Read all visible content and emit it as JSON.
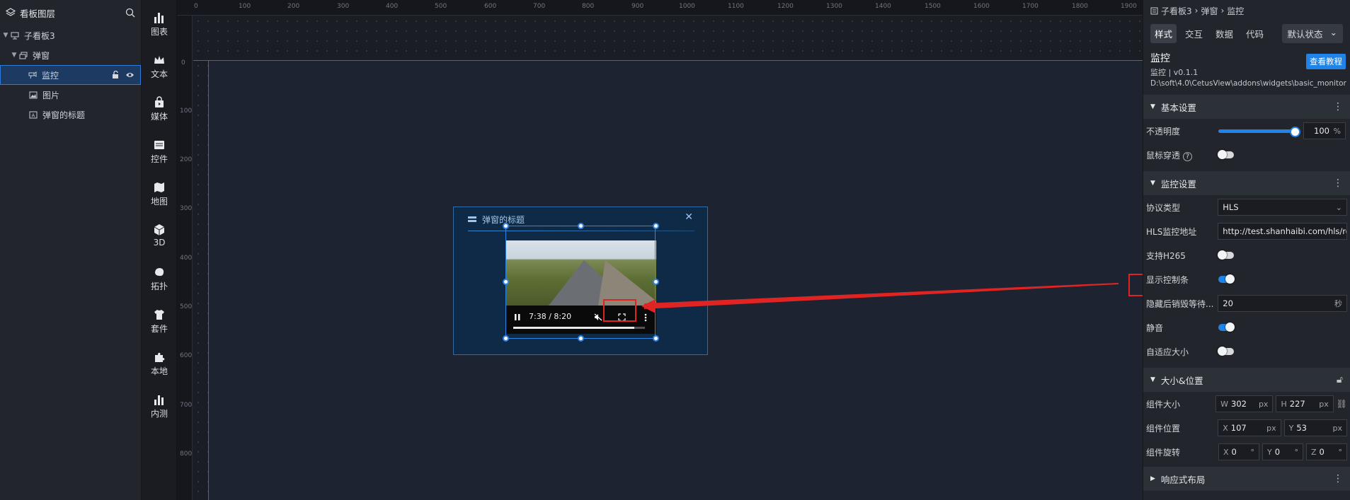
{
  "layers": {
    "title": "看板图层",
    "items": [
      {
        "label": "子看板3"
      },
      {
        "label": "弹窗"
      },
      {
        "label": "监控"
      },
      {
        "label": "图片"
      },
      {
        "label": "弹窗的标题"
      }
    ]
  },
  "toolbar": {
    "items": [
      {
        "label": "图表"
      },
      {
        "label": "文本"
      },
      {
        "label": "媒体"
      },
      {
        "label": "控件"
      },
      {
        "label": "地图"
      },
      {
        "label": "3D"
      },
      {
        "label": "拓扑"
      },
      {
        "label": "套件"
      },
      {
        "label": "本地"
      },
      {
        "label": "内测"
      }
    ]
  },
  "ruler": {
    "top": [
      "0",
      "100",
      "200",
      "300",
      "400",
      "500",
      "600",
      "700",
      "800",
      "900",
      "1000",
      "1100",
      "1200",
      "1300",
      "1400",
      "1500",
      "1600",
      "1700",
      "1800",
      "1900"
    ],
    "left": [
      "0",
      "100",
      "200",
      "300",
      "400",
      "500",
      "600",
      "700",
      "800"
    ]
  },
  "dialog": {
    "title": "弹窗的标题",
    "video": {
      "time": "7:38 / 8:20",
      "progress": 0.92
    }
  },
  "props": {
    "breadcrumb": [
      "子看板3",
      "弹窗",
      "监控"
    ],
    "tabs": [
      "样式",
      "交互",
      "数据",
      "代码"
    ],
    "state": "默认状态",
    "component": {
      "name": "监控",
      "version": "监控 | v0.1.1",
      "path": "D:\\soft\\4.0\\CetusView\\addons\\widgets\\basic_monitor"
    },
    "tutorial_button": "查看教程",
    "sections": {
      "basic": "基本设置",
      "monitor": "监控设置",
      "size": "大小&位置",
      "responsive": "响应式布局"
    },
    "basic": {
      "opacity_label": "不透明度",
      "opacity_value": "100",
      "opacity_unit": "%",
      "mouse_label": "鼠标穿透"
    },
    "monitor": {
      "protocol_label": "协议类型",
      "protocol_value": "HLS",
      "hls_label": "HLS监控地址",
      "hls_value": "http://test.shanhaibi.com/hls/road",
      "h265_label": "支持H265",
      "controls_label": "显示控制条",
      "hide_label": "隐藏后销毁等待...",
      "hide_value": "20",
      "hide_unit": "秒",
      "mute_label": "静音",
      "autosize_label": "自适应大小"
    },
    "size": {
      "size_label": "组件大小",
      "w_label": "W",
      "w_value": "302",
      "h_label": "H",
      "h_value": "227",
      "pos_label": "组件位置",
      "x_label": "X",
      "x_value": "107",
      "y_label": "Y",
      "y_value": "53",
      "px": "px",
      "rot_label": "组件旋转",
      "rx_value": "0",
      "ry_value": "0",
      "rz_value": "0",
      "z_label": "Z",
      "deg": "°"
    }
  }
}
